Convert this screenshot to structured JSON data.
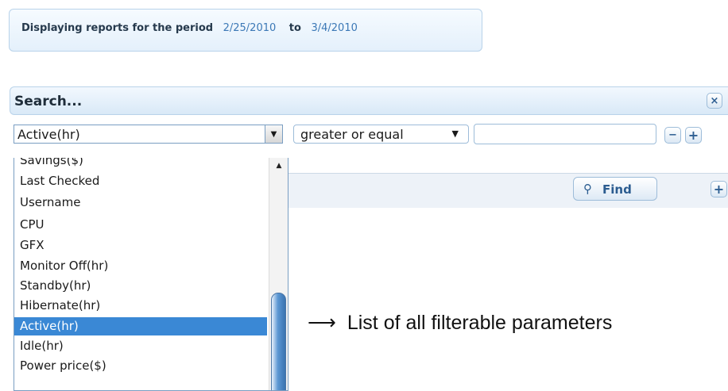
{
  "period": {
    "prefix": "Displaying reports for the period",
    "start_date": "2/25/2010",
    "connector": "to",
    "end_date": "3/4/2010"
  },
  "search": {
    "title": "Search...",
    "close_icon": "×",
    "field_value": "Active(hr)",
    "operator_value": "greater or equal",
    "value_input": "",
    "minus_icon": "−",
    "plus_icon": "+"
  },
  "find": {
    "label": "Find",
    "search_icon": "⚲",
    "add_icon": "+"
  },
  "dropdown": {
    "options": [
      "Savings($)",
      "Last Checked",
      "Username",
      "CPU",
      "GFX",
      "Monitor Off(hr)",
      "Standby(hr)",
      "Hibernate(hr)",
      "Active(hr)",
      "Idle(hr)",
      "Power price($)"
    ],
    "selected": "Active(hr)",
    "scroll_up_icon": "▲"
  },
  "annotation": {
    "arrow": "⟶",
    "text": "List of all filterable parameters"
  },
  "colors": {
    "accent": "#3a88d5",
    "panel_border": "#b9d3ea",
    "date_text": "#3b78b6"
  }
}
